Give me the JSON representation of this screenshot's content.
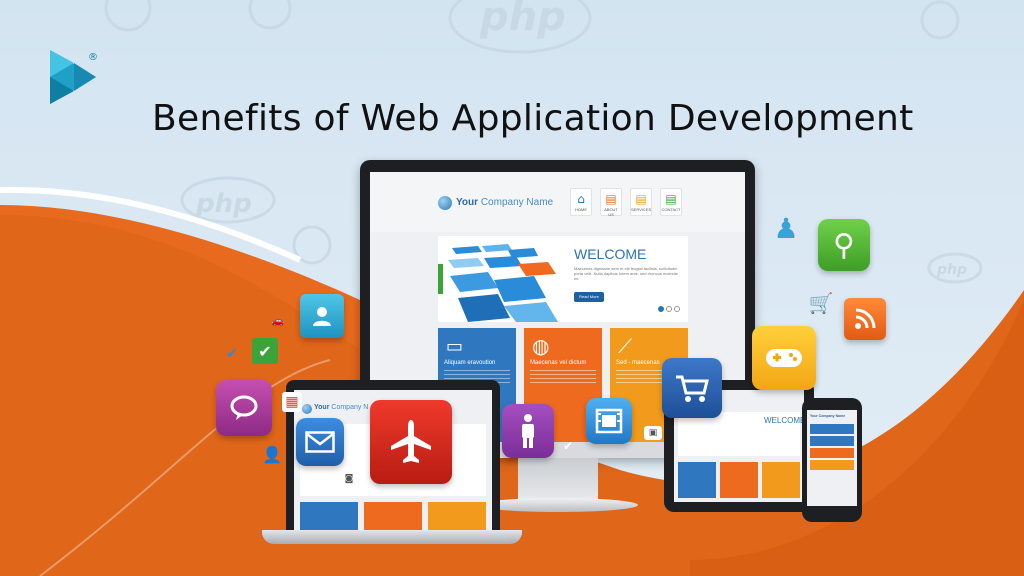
{
  "title": "Benefits of Web Application Development",
  "logo": {
    "name": "brand-logo",
    "mark": "®"
  },
  "background": {
    "watermark_text": "php"
  },
  "monitor": {
    "site_name_bold": "Your",
    "site_name_rest": "Company Name",
    "nav": [
      {
        "icon": "home-icon",
        "glyph": "⌂",
        "label": "HOME",
        "color": "#2b73b5"
      },
      {
        "icon": "document-icon",
        "glyph": "▤",
        "label": "ABOUT US",
        "color": "#e6731e"
      },
      {
        "icon": "document-icon",
        "glyph": "▤",
        "label": "SERVICES",
        "color": "#e6a21e"
      },
      {
        "icon": "document-icon",
        "glyph": "▤",
        "label": "CONTACT",
        "color": "#3aa43a"
      }
    ],
    "welcome": "WELCOME",
    "lorem": "Maecenas dignissim sem et elit feugiat facilisis, sollicitudin porta velit. Nulla dapibus lorem ante, sed rhoncus molestie mi.",
    "read_more": "Read More",
    "features": [
      {
        "title": "Aliquam eravoution",
        "color": "#2f78c0",
        "icon": "chat-icon",
        "glyph": "▭"
      },
      {
        "title": "Maecenas vel dictum",
        "color": "#ee6a1e",
        "icon": "globe-icon",
        "glyph": "◍"
      },
      {
        "title": "Sed - maecenas",
        "color": "#f29a1b",
        "icon": "chart-icon",
        "glyph": "⟋"
      }
    ]
  },
  "laptop": {
    "site_name_bold": "Your",
    "site_name_rest": "Company N"
  },
  "tablet": {
    "welcome": "WELCOME"
  },
  "phone": {
    "site_name": "Your Company Name"
  },
  "icons": [
    {
      "name": "search-icon",
      "glyph": "⚲",
      "color": "#4caf35"
    },
    {
      "name": "gamepad-icon",
      "glyph": "🎮",
      "color": "#f5b21a"
    },
    {
      "name": "rss-icon",
      "glyph": "◠",
      "color": "#f06a1d"
    },
    {
      "name": "cart-icon",
      "glyph": "🛒",
      "color": "#2c5fa8"
    },
    {
      "name": "video-icon",
      "glyph": "🎞",
      "color": "#2a8bd8"
    },
    {
      "name": "person-icon",
      "glyph": "♟",
      "color": "#8d3aa6"
    },
    {
      "name": "airplane-icon",
      "glyph": "✈",
      "color": "#d9261c"
    },
    {
      "name": "mail-icon",
      "glyph": "✉",
      "color": "#2f78c0"
    },
    {
      "name": "speech-bubble-icon",
      "glyph": "💬",
      "color": "#b53a9a"
    },
    {
      "name": "user-icon",
      "glyph": "👤",
      "color": "#2aa3c8"
    },
    {
      "name": "checkmark-icon",
      "glyph": "✔",
      "color": "#3aa43a"
    },
    {
      "name": "calendar-icon",
      "glyph": "▦",
      "color": "#d24b2b"
    }
  ]
}
